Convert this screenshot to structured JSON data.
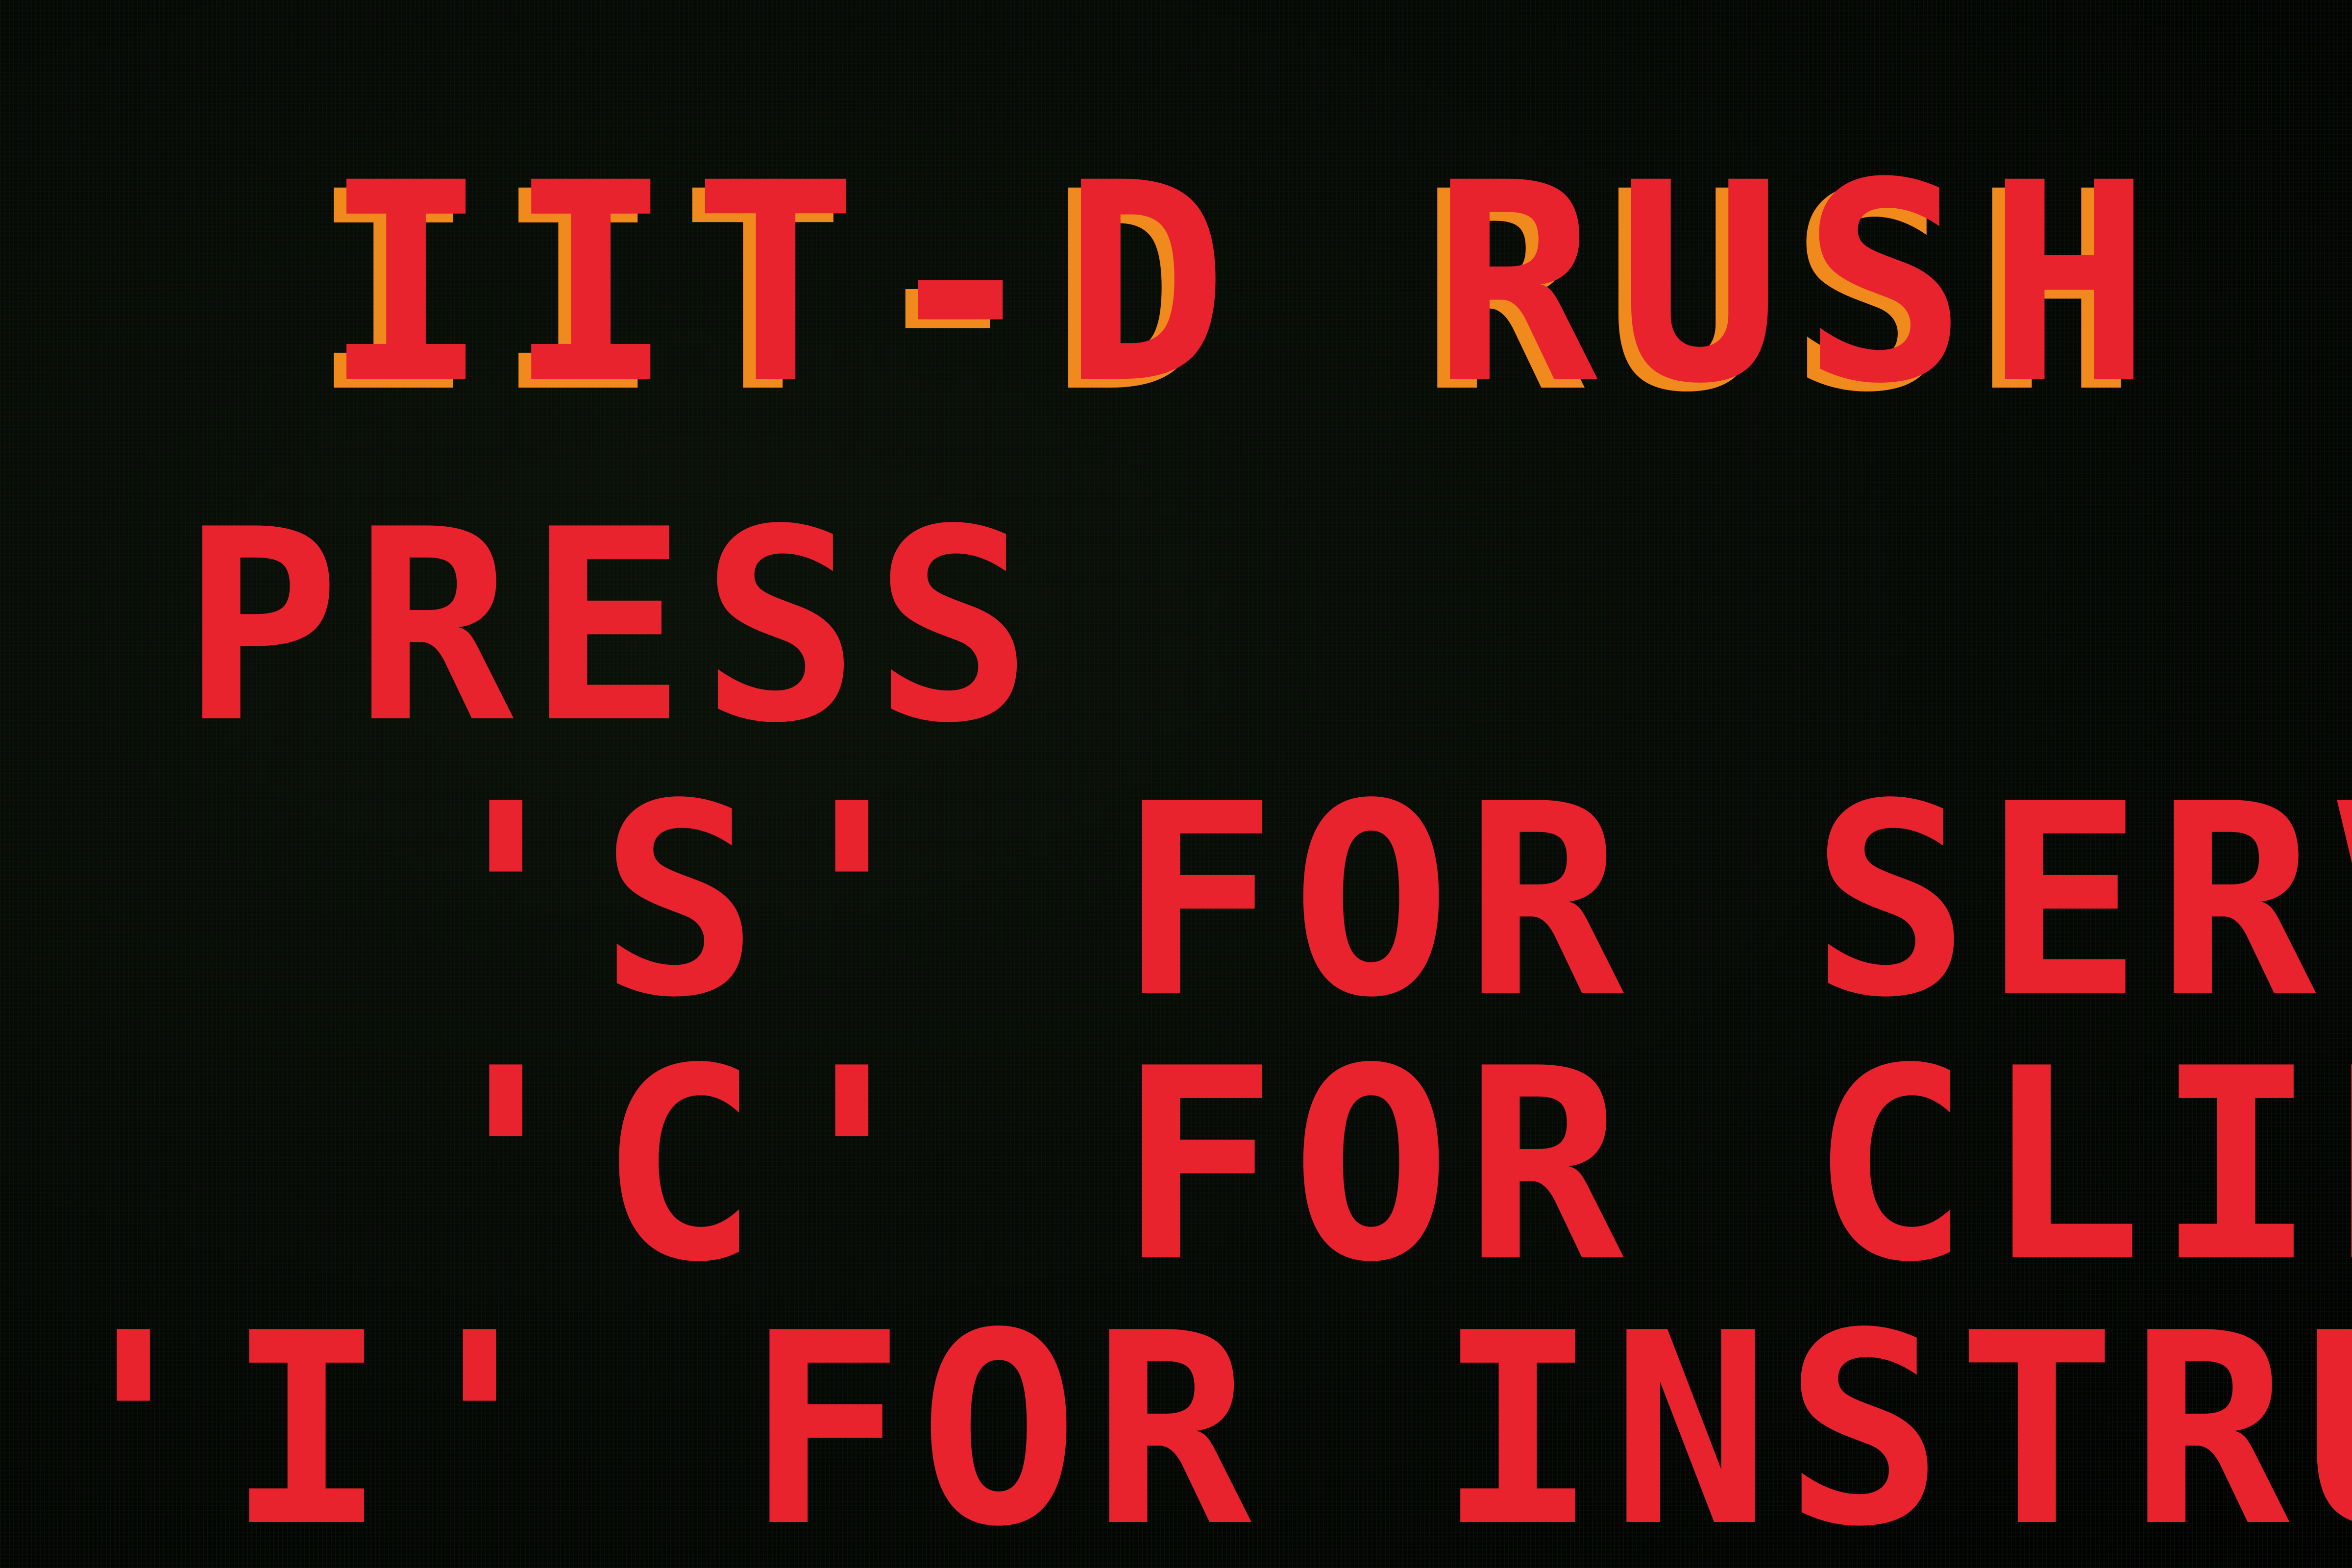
{
  "title": "IIT-D RUSH",
  "prompt": "PRESS",
  "options": [
    {
      "key": "S",
      "text": "'S' FOR SERVER"
    },
    {
      "key": "C",
      "text": "'C' FOR CLIENT"
    },
    {
      "key": "I",
      "text": "'I' FOR INSTRUCTION"
    }
  ],
  "colors": {
    "background": "#000000",
    "text": "#e8232e",
    "title_shadow": "#f08a1c"
  }
}
